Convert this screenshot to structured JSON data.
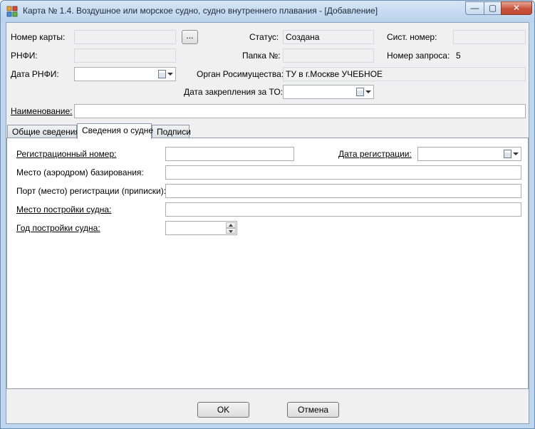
{
  "window": {
    "title": "Карта  № 1.4. Воздушное или морское судно, судно внутреннего плавания - [Добавление]",
    "min_glyph": "—",
    "max_glyph": "▢",
    "close_glyph": "✕"
  },
  "header": {
    "card_number_label": "Номер карты:",
    "card_number_value": "",
    "ellipsis_label": "...",
    "status_label": "Статус:",
    "status_value": "Создана",
    "sys_number_label": "Сист. номер:",
    "sys_number_value": "",
    "rnfi_label": "РНФИ:",
    "rnfi_value": "",
    "folder_label": "Папка №:",
    "folder_value": "",
    "request_number_label": "Номер запроса:",
    "request_number_value": "5",
    "rnfi_date_label": "Дата РНФИ:",
    "org_label": "Орган Росимущества:",
    "org_value": "ТУ в г.Москве УЧЕБНОЕ",
    "to_date_label": "Дата закрепления за ТО:",
    "name_label": "Наименование:",
    "name_value": ""
  },
  "tabs": [
    {
      "label": "Общие сведения"
    },
    {
      "label": "Сведения о судне"
    },
    {
      "label": "Подписи"
    }
  ],
  "vessel": {
    "reg_number_label": "Регистрационный номер:",
    "reg_number_value": "",
    "reg_date_label": "Дата регистрации:",
    "base_place_label": "Место (аэродром) базирования:",
    "base_place_value": "",
    "reg_port_label": "Порт (место) регистрации (приписки):",
    "reg_port_value": "",
    "build_place_label": "Место постройки судна:",
    "build_place_value": "",
    "build_year_label": "Год постройки судна:",
    "build_year_value": ""
  },
  "footer": {
    "ok_label": "OK",
    "cancel_label": "Отмена"
  }
}
